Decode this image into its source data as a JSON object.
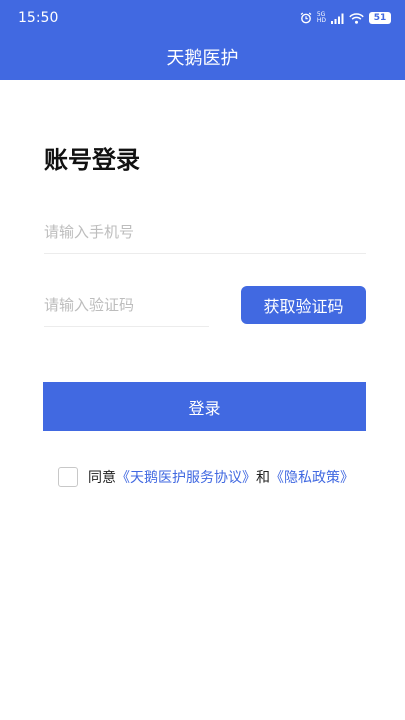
{
  "status_bar": {
    "time": "15:50",
    "network_top": "5G",
    "network_bottom": "HD",
    "battery": "51",
    "icons": [
      "alarm-icon",
      "signal-icon",
      "wifi-icon",
      "battery-icon"
    ]
  },
  "header": {
    "title": "天鹅医护",
    "background": "#4169e1"
  },
  "login": {
    "title": "账号登录",
    "phone_placeholder": "请输入手机号",
    "code_placeholder": "请输入验证码",
    "get_code_label": "获取验证码",
    "submit_label": "登录"
  },
  "agreement": {
    "prefix": "同意",
    "service_link": "《天鹅医护服务协议》",
    "conjunction": "和",
    "privacy_link": "《隐私政策》",
    "checked": false
  },
  "colors": {
    "accent": "#4169e1",
    "placeholder": "#bdbdbd",
    "divider": "#ececec"
  }
}
